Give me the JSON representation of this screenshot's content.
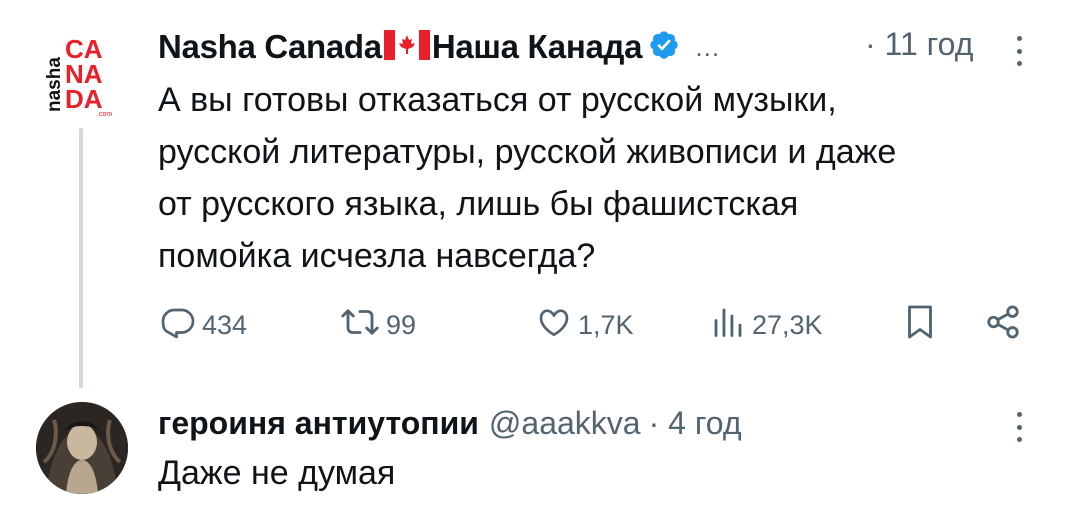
{
  "post": {
    "display_name": "Nasha Canada",
    "display_name_ru": "Наша Канада",
    "ellipsis": "…",
    "time": "· 11 год",
    "logo_text": [
      "nasha",
      "CA",
      "NA",
      "DA",
      ".com"
    ],
    "text_lines": [
      "А вы готовы отказаться от русской музыки,",
      "русской литературы, русской живописи и даже",
      "от русского языка, лишь бы фашистская",
      "помойка исчезла навсегда?"
    ],
    "actions": {
      "replies": "434",
      "reposts": "99",
      "likes": "1,7K",
      "views": "27,3K"
    }
  },
  "reply": {
    "display_name": "героиня антиутопии",
    "handle": "@aaakkva",
    "time": "· 4 год",
    "text": "Даже не думая"
  },
  "icons": {
    "verified": "verified-badge-icon",
    "flag": "canada-flag-icon",
    "reply": "reply-icon",
    "repost": "repost-icon",
    "like": "heart-icon",
    "views": "views-icon",
    "bookmark": "bookmark-icon",
    "share": "share-icon",
    "more": "more-icon"
  },
  "colors": {
    "logo_red": "#e8202a",
    "verified_blue": "#1d9bf0",
    "secondary_text": "#536471"
  }
}
